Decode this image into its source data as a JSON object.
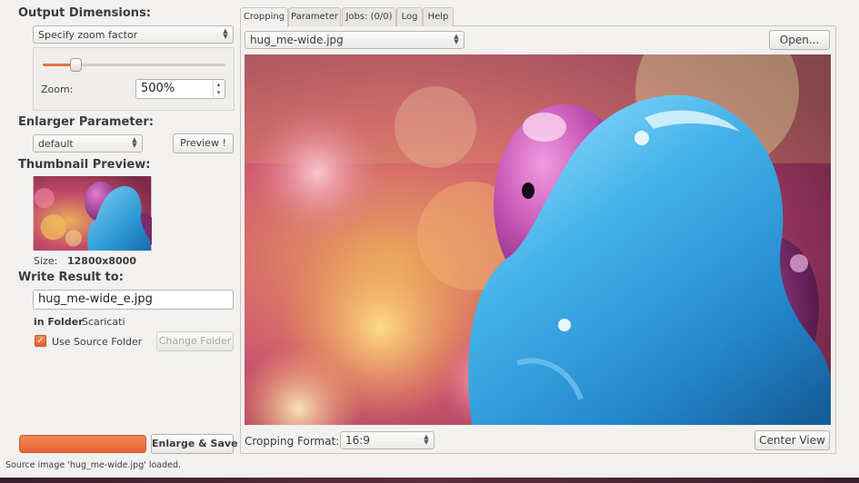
{
  "left": {
    "output_dimensions": {
      "title": "Output Dimensions:",
      "mode_select": "Specify zoom factor",
      "zoom_label": "Zoom:",
      "zoom_value": "500%",
      "slider_fraction": 0.18
    },
    "enlarger": {
      "title": "Enlarger Parameter:",
      "preset_select": "default",
      "preview_button": "Preview !"
    },
    "thumbnail": {
      "title": "Thumbnail Preview:",
      "size_label": "Size:",
      "size_value": "12800x8000"
    },
    "write_result": {
      "title": "Write Result to:",
      "filename": "hug_me-wide_e.jpg",
      "folder_label": "in Folder",
      "folder_value": "Scaricati",
      "use_source_label": "Use Source Folder",
      "use_source_checked": true,
      "change_folder_button": "Change Folder"
    },
    "enlarge_save_button": "Enlarge & Save"
  },
  "tabs": [
    {
      "label": "Cropping",
      "active": true
    },
    {
      "label": "Parameter",
      "active": false
    },
    {
      "label": "Jobs: (0/0)",
      "active": false
    },
    {
      "label": "Log",
      "active": false
    },
    {
      "label": "Help",
      "active": false
    }
  ],
  "cropping": {
    "file_select": "hug_me-wide.jpg",
    "open_button": "Open...",
    "format_label": "Cropping Format:",
    "format_value": "16:9",
    "center_view_button": "Center View"
  },
  "status": "Source image 'hug_me-wide.jpg' loaded.",
  "colors": {
    "accent": "#e8713f",
    "blue_figure": "#3aa4dc",
    "purple_figure": "#b2479d"
  }
}
